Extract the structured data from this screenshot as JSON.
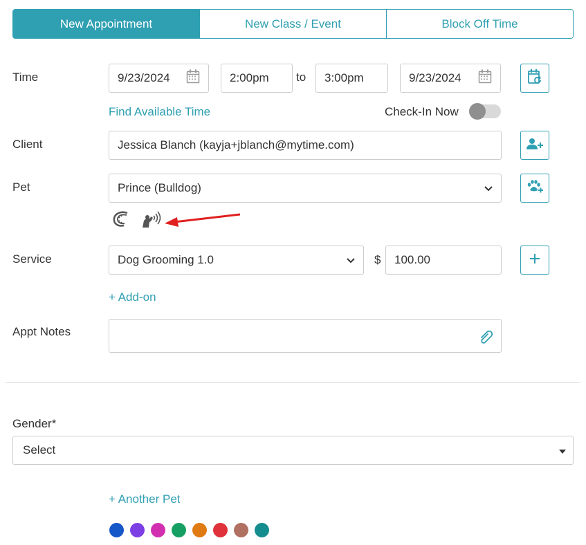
{
  "tabs": [
    {
      "label": "New Appointment",
      "active": true
    },
    {
      "label": "New Class / Event",
      "active": false
    },
    {
      "label": "Block Off Time",
      "active": false
    }
  ],
  "time": {
    "label": "Time",
    "start_date": "9/23/2024",
    "start_time": "2:00pm",
    "to_label": "to",
    "end_time": "3:00pm",
    "end_date": "9/23/2024",
    "find_available_time": "Find Available Time",
    "check_in_label": "Check-In Now",
    "check_in_on": false
  },
  "client": {
    "label": "Client",
    "value": "Jessica Blanch (kayja+jblanch@mytime.com)"
  },
  "pet": {
    "label": "Pet",
    "value": "Prince (Bulldog)",
    "status_icons": [
      "bite-warning-icon",
      "barking-icon"
    ]
  },
  "service": {
    "label": "Service",
    "value": "Dog Grooming 1.0",
    "currency": "$",
    "price": "100.00",
    "add_on": "+ Add-on"
  },
  "notes": {
    "label": "Appt Notes",
    "value": ""
  },
  "gender": {
    "label": "Gender*",
    "selected": "Select"
  },
  "another_pet": "+ Another Pet",
  "colors": {
    "accent": "#2f9fb2",
    "annotation_arrow": "#e02020",
    "swatches": [
      "#1556c9",
      "#7b3fe4",
      "#d12fb0",
      "#169f62",
      "#e07a12",
      "#e0323a",
      "#b07062",
      "#158c8e"
    ]
  }
}
